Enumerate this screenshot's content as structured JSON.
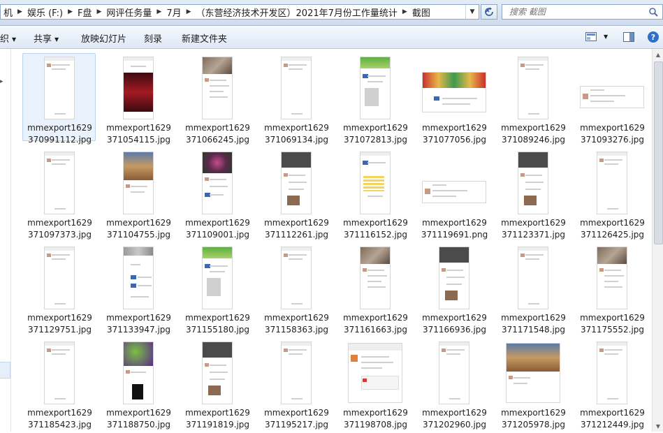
{
  "address": {
    "crumbs": [
      "机",
      "娱乐 (F:)",
      "F盘",
      "网评任务量",
      "7月",
      "（东营经济技术开发区）2021年7月份工作量统计",
      "截图"
    ]
  },
  "search": {
    "placeholder": "搜索 截图"
  },
  "toolbar": {
    "organize_partial": "织",
    "share_label": "共享",
    "slideshow_label": "放映幻灯片",
    "burn_label": "刻录",
    "new_folder_label": "新建文件夹"
  },
  "files": [
    {
      "name1": "mmexport1629",
      "name2": "370991112.jpg",
      "thumb": "portrait",
      "style": "plain"
    },
    {
      "name1": "mmexport1629",
      "name2": "371054115.jpg",
      "thumb": "portrait",
      "style": "red"
    },
    {
      "name1": "mmexport1629",
      "name2": "371066245.jpg",
      "thumb": "portrait",
      "style": "photo-top"
    },
    {
      "name1": "mmexport1629",
      "name2": "371069134.jpg",
      "thumb": "portrait",
      "style": "plain"
    },
    {
      "name1": "mmexport1629",
      "name2": "371072813.jpg",
      "thumb": "portrait",
      "style": "green-top"
    },
    {
      "name1": "mmexport1629",
      "name2": "371077056.jpg",
      "thumb": "wide",
      "style": "wide-pic"
    },
    {
      "name1": "mmexport1629",
      "name2": "371089246.jpg",
      "thumb": "portrait",
      "style": "plain"
    },
    {
      "name1": "mmexport1629",
      "name2": "371093276.jpg",
      "thumb": "wide2",
      "style": "wide-text"
    },
    {
      "name1": "mmexport1629",
      "name2": "371097373.jpg",
      "thumb": "portrait",
      "style": "plain"
    },
    {
      "name1": "mmexport1629",
      "name2": "371104755.jpg",
      "thumb": "portrait",
      "style": "desert-top"
    },
    {
      "name1": "mmexport1629",
      "name2": "371109001.jpg",
      "thumb": "portrait",
      "style": "flower-top"
    },
    {
      "name1": "mmexport1629",
      "name2": "371112261.jpg",
      "thumb": "portrait",
      "style": "dark-top"
    },
    {
      "name1": "mmexport1629",
      "name2": "371116152.jpg",
      "thumb": "portrait",
      "style": "yellow-mid"
    },
    {
      "name1": "mmexport1629",
      "name2": "371119691.png",
      "thumb": "wide2",
      "style": "wide-text"
    },
    {
      "name1": "mmexport1629",
      "name2": "371123371.jpg",
      "thumb": "portrait",
      "style": "dark-top"
    },
    {
      "name1": "mmexport1629",
      "name2": "371126425.jpg",
      "thumb": "portrait",
      "style": "plain"
    },
    {
      "name1": "mmexport1629",
      "name2": "371129751.jpg",
      "thumb": "portrait",
      "style": "plain"
    },
    {
      "name1": "mmexport1629",
      "name2": "371133947.jpg",
      "thumb": "portrait",
      "style": "gray-top"
    },
    {
      "name1": "mmexport1629",
      "name2": "371155180.jpg",
      "thumb": "portrait",
      "style": "green-top"
    },
    {
      "name1": "mmexport1629",
      "name2": "371158363.jpg",
      "thumb": "portrait",
      "style": "plain"
    },
    {
      "name1": "mmexport1629",
      "name2": "371161663.jpg",
      "thumb": "portrait",
      "style": "photo-top"
    },
    {
      "name1": "mmexport1629",
      "name2": "371166936.jpg",
      "thumb": "portrait",
      "style": "dark-top"
    },
    {
      "name1": "mmexport1629",
      "name2": "371171548.jpg",
      "thumb": "portrait",
      "style": "plain"
    },
    {
      "name1": "mmexport1629",
      "name2": "371175552.jpg",
      "thumb": "portrait",
      "style": "photo-top"
    },
    {
      "name1": "mmexport1629",
      "name2": "371185423.jpg",
      "thumb": "portrait",
      "style": "plain"
    },
    {
      "name1": "mmexport1629",
      "name2": "371188750.jpg",
      "thumb": "portrait",
      "style": "purple-top"
    },
    {
      "name1": "mmexport1629",
      "name2": "371191819.jpg",
      "thumb": "portrait",
      "style": "dark-top"
    },
    {
      "name1": "mmexport1629",
      "name2": "371195217.jpg",
      "thumb": "portrait",
      "style": "plain"
    },
    {
      "name1": "mmexport1629",
      "name2": "371198708.jpg",
      "thumb": "tallwide",
      "style": "moments"
    },
    {
      "name1": "mmexport1629",
      "name2": "371202960.jpg",
      "thumb": "portrait",
      "style": "plain"
    },
    {
      "name1": "mmexport1629",
      "name2": "371205978.jpg",
      "thumb": "tallwide",
      "style": "desert-top"
    },
    {
      "name1": "mmexport1629",
      "name2": "371212449.jpg",
      "thumb": "portrait",
      "style": "plain"
    }
  ],
  "colors": {
    "accent": "#2f6fc7",
    "selection_bg": "#eaf3fd",
    "selection_border": "#b7d5f2"
  }
}
